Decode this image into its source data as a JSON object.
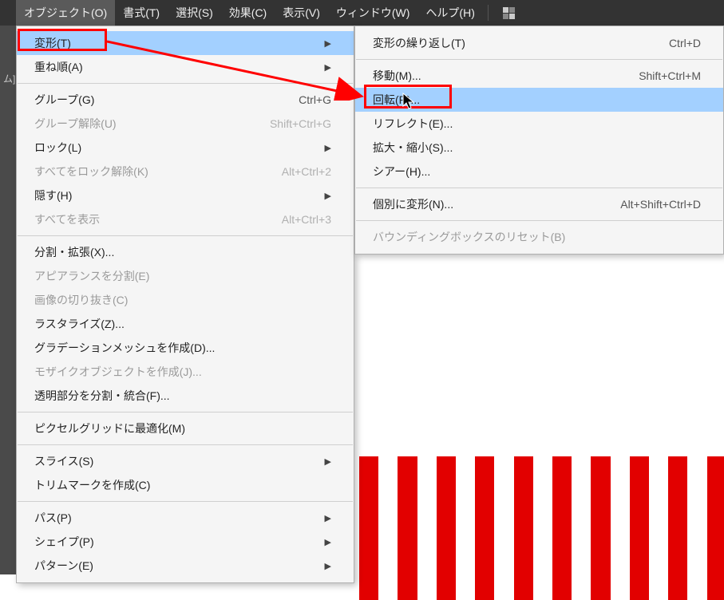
{
  "menubar": {
    "object": "オブジェクト(O)",
    "type": "書式(T)",
    "select": "選択(S)",
    "effect": "効果(C)",
    "view": "表示(V)",
    "window": "ウィンドウ(W)",
    "help": "ヘルプ(H)"
  },
  "leftstrip": {
    "label": "ム]"
  },
  "main": {
    "transform": "変形(T)",
    "arrange": "重ね順(A)",
    "group": "グループ(G)",
    "group_sc": "Ctrl+G",
    "ungroup": "グループ解除(U)",
    "ungroup_sc": "Shift+Ctrl+G",
    "lock": "ロック(L)",
    "unlock_all": "すべてをロック解除(K)",
    "unlock_all_sc": "Alt+Ctrl+2",
    "hide": "隠す(H)",
    "show_all": "すべてを表示",
    "show_all_sc": "Alt+Ctrl+3",
    "expand": "分割・拡張(X)...",
    "expand_appearance": "アピアランスを分割(E)",
    "crop_image": "画像の切り抜き(C)",
    "rasterize": "ラスタライズ(Z)...",
    "create_gradient_mesh": "グラデーションメッシュを作成(D)...",
    "create_mosaic": "モザイクオブジェクトを作成(J)...",
    "flatten": "透明部分を分割・統合(F)...",
    "pixel_perfect": "ピクセルグリッドに最適化(M)",
    "slice": "スライス(S)",
    "trim_marks": "トリムマークを作成(C)",
    "path": "パス(P)",
    "shape": "シェイプ(P)",
    "pattern": "パターン(E)"
  },
  "sub": {
    "transform_again": "変形の繰り返し(T)",
    "transform_again_sc": "Ctrl+D",
    "move": "移動(M)...",
    "move_sc": "Shift+Ctrl+M",
    "rotate": "回転(R)...",
    "reflect": "リフレクト(E)...",
    "scale": "拡大・縮小(S)...",
    "shear": "シアー(H)...",
    "transform_each": "個別に変形(N)...",
    "transform_each_sc": "Alt+Shift+Ctrl+D",
    "reset_bbox": "バウンディングボックスのリセット(B)"
  }
}
